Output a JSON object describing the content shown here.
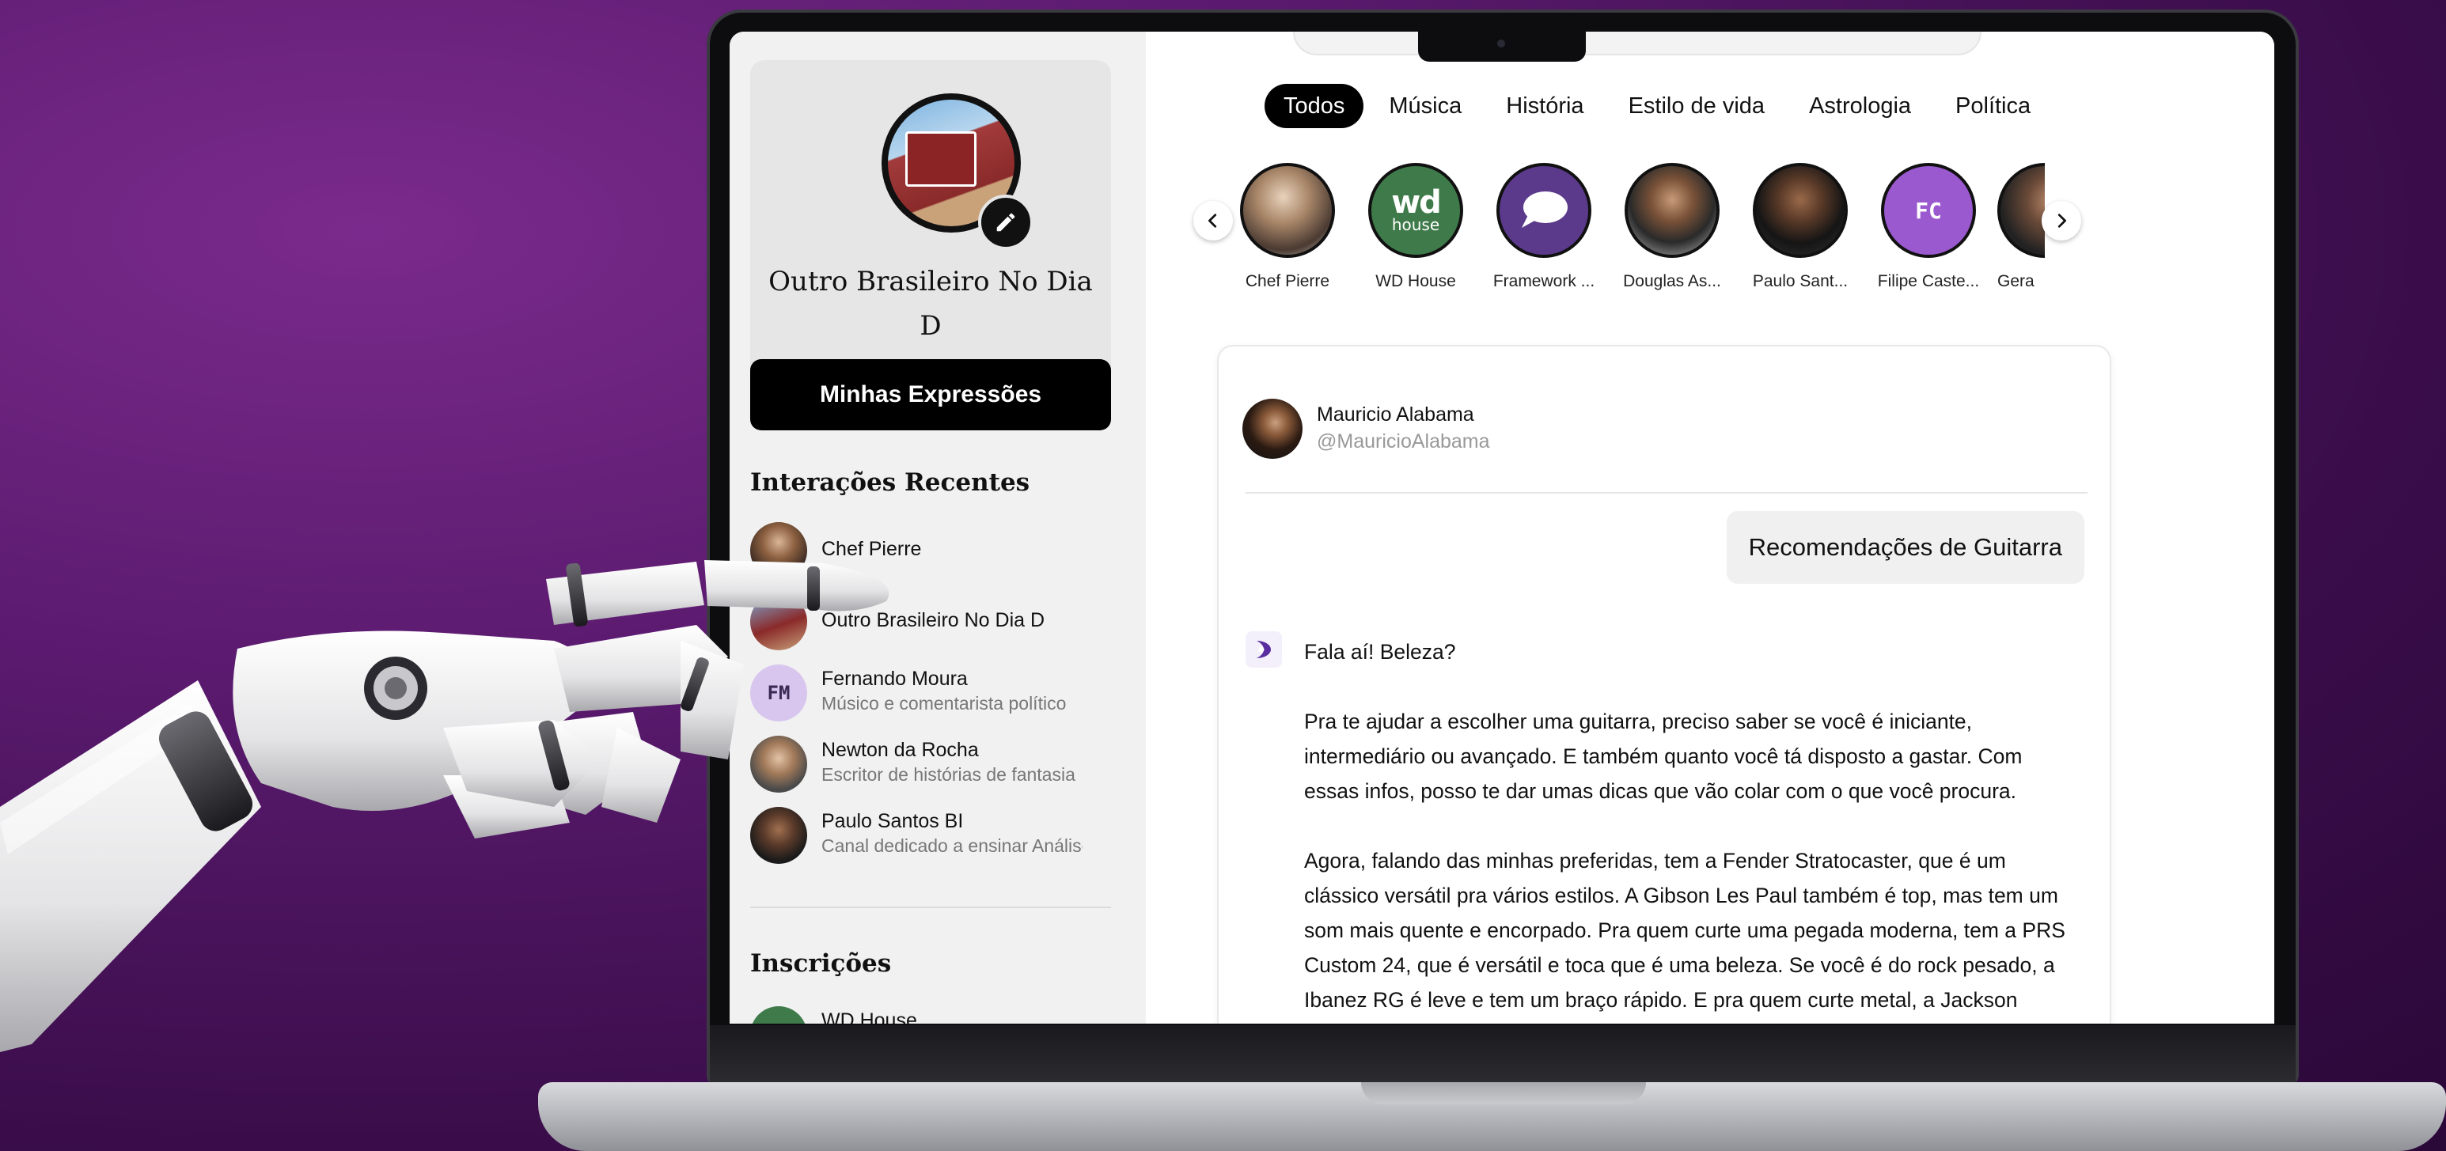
{
  "sidebar": {
    "profile_name": "Outro Brasileiro No Dia D",
    "primary_button": "Minhas Expressões",
    "recent_title": "Interações Recentes",
    "recent": [
      {
        "name": "Chef Pierre",
        "desc": "",
        "initials": ""
      },
      {
        "name": "Outro Brasileiro No Dia D",
        "desc": "",
        "initials": ""
      },
      {
        "name": "Fernando Moura",
        "desc": "Músico e comentarista político",
        "initials": "FM"
      },
      {
        "name": "Newton da Rocha",
        "desc": "Escritor de histórias de fantasia",
        "initials": ""
      },
      {
        "name": "Paulo Santos BI",
        "desc": "Canal dedicado a ensinar Análise",
        "initials": ""
      }
    ],
    "subs_title": "Inscrições",
    "subs": [
      {
        "name": "WD House"
      }
    ]
  },
  "tabs": [
    "Todos",
    "Música",
    "História",
    "Estilo de vida",
    "Astrologia",
    "Política"
  ],
  "creators": [
    {
      "name": "Chef Pierre"
    },
    {
      "name": "WD House",
      "logo": "wd",
      "logo_sub": "house"
    },
    {
      "name": "Framework ..."
    },
    {
      "name": "Douglas As..."
    },
    {
      "name": "Paulo Sant..."
    },
    {
      "name": "Filipe Caste...",
      "initials": "FC"
    },
    {
      "name": "Gera"
    }
  ],
  "chat": {
    "author_name": "Mauricio Alabama",
    "author_handle": "@MauricioAlabama",
    "user_message": "Recomendações de Guitarra",
    "reply_greeting": "Fala aí! Beleza?",
    "reply_p1": "Pra te ajudar a escolher uma guitarra, preciso saber se você é iniciante, intermediário ou avançado. E também quanto você tá disposto a gastar. Com essas infos, posso te dar umas dicas que vão colar com o que você procura.",
    "reply_p2": "Agora, falando das minhas preferidas, tem a Fender Stratocaster, que é um clássico versátil pra vários estilos. A Gibson Les Paul também é top, mas tem um som mais quente e encorpado. Pra quem curte uma pegada moderna, tem a PRS Custom 24, que é versátil e toca que é uma beleza. Se você é do rock pesado, a Ibanez RG é leve e tem um braço rápido. E pra quem curte metal, a Jackson Soloist"
  },
  "icons": {
    "edit": "pencil-icon",
    "prev": "chevron-left-icon",
    "next": "chevron-right-icon",
    "bot": "bot-logo-icon"
  },
  "colors": {
    "background": "#5a1a6e",
    "active_tab": "#000000",
    "framework_avatar": "#5b3a8c",
    "wd_avatar": "#3f7a4a",
    "fc_avatar": "#9b59d0",
    "fm_avatar": "#d8c6ee"
  }
}
